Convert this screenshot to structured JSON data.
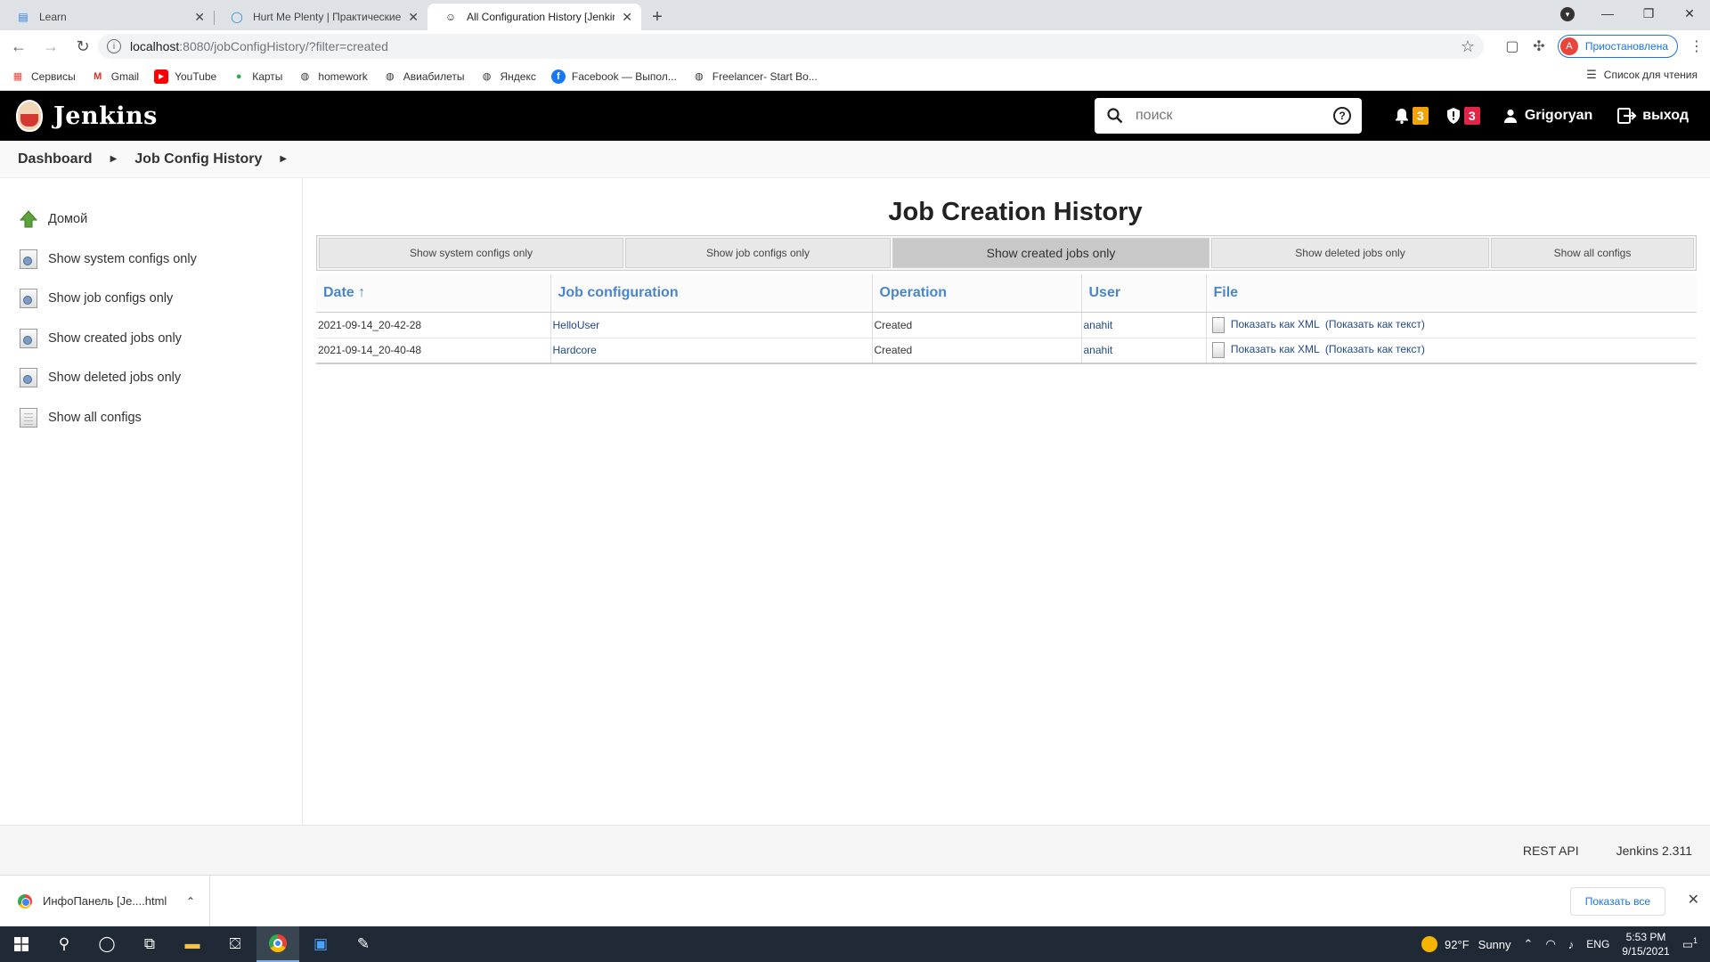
{
  "browser": {
    "tabs": [
      {
        "title": "Learn",
        "icon": "book-icon"
      },
      {
        "title": "Hurt Me Plenty | Практические з",
        "icon": "circle-icon"
      },
      {
        "title": "All Configuration History [Jenkins",
        "icon": "jenkins-icon"
      }
    ],
    "url_host": "localhost",
    "url_path": ":8080/jobConfigHistory/?filter=created",
    "profile_initial": "A",
    "profile_label": "Приостановлена",
    "reading_list": "Список для чтения",
    "bookmarks": [
      {
        "label": "Сервисы",
        "icon": "apps-grid-icon"
      },
      {
        "label": "Gmail",
        "icon": "gmail-icon"
      },
      {
        "label": "YouTube",
        "icon": "youtube-icon"
      },
      {
        "label": "Карты",
        "icon": "maps-pin-icon"
      },
      {
        "label": "homework",
        "icon": "globe-icon"
      },
      {
        "label": "Авиабилеты",
        "icon": "globe-icon"
      },
      {
        "label": "Яндекс",
        "icon": "globe-icon"
      },
      {
        "label": "Facebook — Выпол...",
        "icon": "facebook-icon"
      },
      {
        "label": "Freelancer- Start Bo...",
        "icon": "globe-icon"
      }
    ]
  },
  "jenkins": {
    "brand": "Jenkins",
    "search_placeholder": "поиск",
    "notifications_count": "3",
    "security_count": "3",
    "user": "Grigoryan",
    "logout": "выход",
    "colors": {
      "notif_badge": "#f0a30a",
      "security_badge": "#e0254a",
      "link": "#4a86c9"
    }
  },
  "breadcrumb": {
    "items": [
      "Dashboard",
      "Job Config History"
    ]
  },
  "sidebar": {
    "items": [
      {
        "label": "Домой",
        "icon": "up-arrow-home-icon"
      },
      {
        "label": "Show system configs only",
        "icon": "config-document-icon"
      },
      {
        "label": "Show job configs only",
        "icon": "config-document-icon"
      },
      {
        "label": "Show created jobs only",
        "icon": "config-document-icon"
      },
      {
        "label": "Show deleted jobs only",
        "icon": "config-document-icon"
      },
      {
        "label": "Show all configs",
        "icon": "document-icon"
      }
    ]
  },
  "main": {
    "title": "Job Creation History",
    "filters": [
      {
        "label": "Show system configs only"
      },
      {
        "label": "Show job configs only"
      },
      {
        "label": "Show created jobs only",
        "active": true
      },
      {
        "label": "Show deleted jobs only"
      },
      {
        "label": "Show all configs"
      }
    ],
    "table": {
      "headers": [
        "Date ↑",
        "Job configuration",
        "Operation",
        "User",
        "File"
      ],
      "rows": [
        {
          "date": "2021-09-14_20-42-28",
          "job": "HelloUser",
          "operation": "Created",
          "user": "anahit",
          "xml": "Показать как XML",
          "text": "(Показать как текст)"
        },
        {
          "date": "2021-09-14_20-40-48",
          "job": "Hardcore",
          "operation": "Created",
          "user": "anahit",
          "xml": "Показать как XML",
          "text": "(Показать как текст)"
        }
      ]
    }
  },
  "footer": {
    "rest_api": "REST API",
    "version": "Jenkins 2.311"
  },
  "downloads": {
    "item": "ИнфоПанель [Je....html",
    "show_all": "Показать все"
  },
  "taskbar": {
    "temperature": "92°F",
    "weather": "Sunny",
    "lang": "ENG",
    "time": "5:53 PM",
    "date": "9/15/2021",
    "notification_count": "1"
  }
}
